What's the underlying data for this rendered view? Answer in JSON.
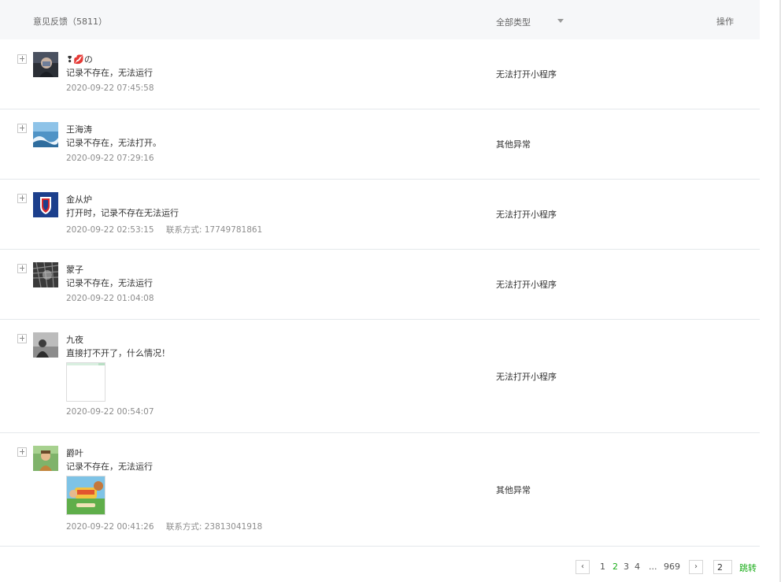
{
  "header": {
    "title": "意见反馈（5811）",
    "filter_label": "全部类型",
    "action_label": "操作"
  },
  "rows": [
    {
      "name": "❢💋の",
      "content": "记录不存在，无法运行",
      "time": "2020-09-22 07:45:58",
      "contact": "",
      "type": "无法打开小程序"
    },
    {
      "name": "王海涛",
      "content": "记录不存在，无法打开。",
      "time": "2020-09-22 07:29:16",
      "contact": "",
      "type": "其他异常"
    },
    {
      "name": "金从炉",
      "content": "打开时，记录不存在无法运行",
      "time": "2020-09-22 02:53:15",
      "contact": "联系方式: 17749781861",
      "type": "无法打开小程序"
    },
    {
      "name": "蒙子",
      "content": "记录不存在，无法运行",
      "time": "2020-09-22 01:04:08",
      "contact": "",
      "type": "无法打开小程序"
    },
    {
      "name": "九夜",
      "content": "直接打不开了，什么情况！",
      "time": "2020-09-22 00:54:07",
      "contact": "",
      "type": "无法打开小程序"
    },
    {
      "name": "爵叶",
      "content": "记录不存在，无法运行",
      "time": "2020-09-22 00:41:26",
      "contact": "联系方式: 23813041918",
      "type": "其他异常"
    }
  ],
  "pagination": {
    "prev": "‹",
    "pages": [
      "1",
      "2",
      "3",
      "4"
    ],
    "current": "2",
    "ellipsis": "...",
    "last": "969",
    "next": "›",
    "input_value": "2",
    "jump_label": "跳转"
  },
  "colors": {
    "accent": "#1aad19",
    "header_bg": "#f6f7f9",
    "divider": "#e4e8eb"
  }
}
